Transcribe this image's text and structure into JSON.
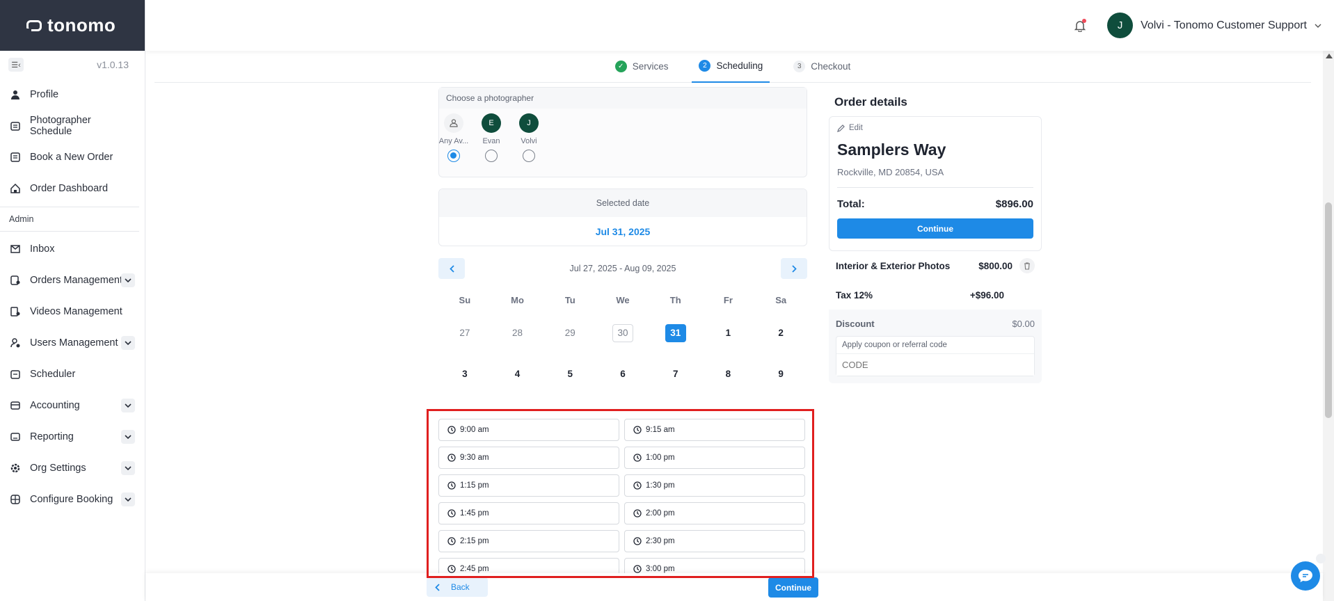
{
  "brand": {
    "name": "tonomo"
  },
  "sidebar": {
    "version": "v1.0.13",
    "items": [
      {
        "label": "Profile",
        "icon": "person-icon"
      },
      {
        "label": "Photographer Schedule",
        "icon": "calendar-icon"
      },
      {
        "label": "Book a New Order",
        "icon": "document-icon"
      },
      {
        "label": "Order Dashboard",
        "icon": "home-icon"
      }
    ],
    "admin_label": "Admin",
    "admin_items": [
      {
        "label": "Inbox",
        "icon": "mail-icon",
        "expandable": false
      },
      {
        "label": "Orders Management",
        "icon": "orders-icon",
        "expandable": true
      },
      {
        "label": "Videos Management",
        "icon": "video-icon",
        "expandable": false
      },
      {
        "label": "Users Management",
        "icon": "users-icon",
        "expandable": true
      },
      {
        "label": "Scheduler",
        "icon": "scheduler-icon",
        "expandable": false
      },
      {
        "label": "Accounting",
        "icon": "wallet-icon",
        "expandable": true
      },
      {
        "label": "Reporting",
        "icon": "chart-icon",
        "expandable": true
      },
      {
        "label": "Org Settings",
        "icon": "gear-icon",
        "expandable": true
      },
      {
        "label": "Configure Booking",
        "icon": "grid-icon",
        "expandable": true
      }
    ]
  },
  "header": {
    "user_initial": "J",
    "user_name": "Volvi - Tonomo Customer Support"
  },
  "steps": [
    {
      "num": "✓",
      "label": "Services",
      "state": "done"
    },
    {
      "num": "2",
      "label": "Scheduling",
      "state": "active"
    },
    {
      "num": "3",
      "label": "Checkout",
      "state": "todo"
    }
  ],
  "photographer": {
    "title": "Choose a photographer",
    "options": [
      {
        "initial": "",
        "name": "Any Av...",
        "selected": true
      },
      {
        "initial": "E",
        "name": "Evan",
        "selected": false
      },
      {
        "initial": "J",
        "name": "Volvi",
        "selected": false
      }
    ]
  },
  "selected_date": {
    "label": "Selected date",
    "value": "Jul 31, 2025"
  },
  "calendar": {
    "range": "Jul 27, 2025 - Aug 09, 2025",
    "weekdays": [
      "Su",
      "Mo",
      "Tu",
      "We",
      "Th",
      "Fr",
      "Sa"
    ],
    "week1": [
      "27",
      "28",
      "29",
      "30",
      "31",
      "1",
      "2"
    ],
    "week2": [
      "3",
      "4",
      "5",
      "6",
      "7",
      "8",
      "9"
    ]
  },
  "slots": [
    "9:00 am",
    "9:15 am",
    "9:30 am",
    "1:00 pm",
    "1:15 pm",
    "1:30 pm",
    "1:45 pm",
    "2:00 pm",
    "2:15 pm",
    "2:30 pm",
    "2:45 pm",
    "3:00 pm"
  ],
  "order": {
    "title": "Order details",
    "edit_label": "Edit",
    "property": "Samplers Way",
    "address": "Rockville, MD 20854, USA",
    "total_label": "Total:",
    "total_value": "$896.00",
    "continue_label": "Continue",
    "line_label": "Interior & Exterior Photos",
    "line_value": "$800.00",
    "tax_label": "Tax 12%",
    "tax_value": "+$96.00",
    "discount_label": "Discount",
    "discount_value": "$0.00",
    "coupon_label": "Apply coupon or referral code",
    "coupon_placeholder": "CODE"
  },
  "footer": {
    "back_label": "Back",
    "continue_label": "Continue"
  },
  "colors": {
    "accent": "#1e8ae6",
    "brand_bg": "#2f3543",
    "success": "#25a35a",
    "avatar": "#0f4d3c",
    "highlight": "#e01f1f"
  }
}
